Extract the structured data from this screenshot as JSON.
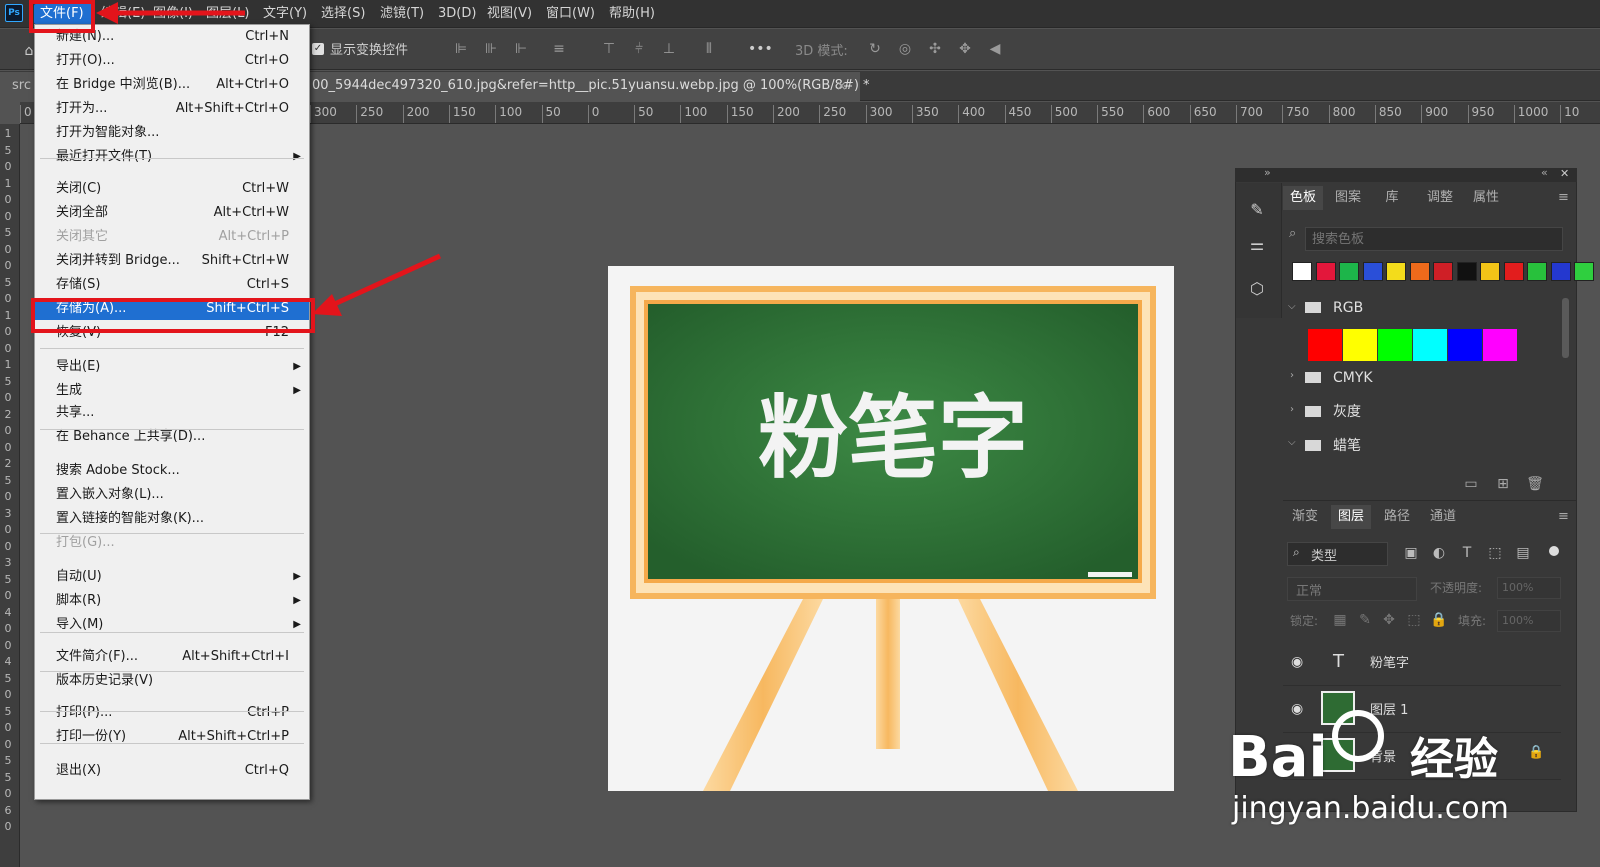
{
  "menubar": {
    "ps_logo": "Ps",
    "items": [
      "文件(F)",
      "编辑(E)",
      "图像(I)",
      "图层(L)",
      "文字(Y)",
      "选择(S)",
      "滤镜(T)",
      "3D(D)",
      "视图(V)",
      "窗口(W)",
      "帮助(H)"
    ]
  },
  "options": {
    "show_transform": "显示变换控件",
    "more": "•••",
    "mode3d": "3D 模式:"
  },
  "document": {
    "src_tab": "src",
    "tab_title": "00_5944dec497320_610.jpg&refer=http__pic.51yuansu.webp.jpg @ 100%(RGB/8#) *",
    "close": "×"
  },
  "ruler": {
    "h": [
      "0",
      "300",
      "250",
      "200",
      "150",
      "100",
      "50",
      "0",
      "50",
      "100",
      "150",
      "200",
      "250",
      "300",
      "350",
      "400",
      "450",
      "500",
      "550",
      "600",
      "650",
      "700",
      "750",
      "800",
      "850",
      "900",
      "950",
      "1000",
      "10"
    ],
    "v": [
      "1",
      "5",
      "0",
      "1",
      "0",
      "0",
      "5",
      "0",
      "0",
      "5",
      "0",
      "1",
      "0",
      "0",
      "1",
      "5",
      "0",
      "2",
      "0",
      "0",
      "2",
      "5",
      "0",
      "3",
      "0",
      "0",
      "3",
      "5",
      "0",
      "4",
      "0",
      "0",
      "4",
      "5",
      "0",
      "5",
      "0",
      "0",
      "5",
      "5",
      "0",
      "6",
      "0"
    ]
  },
  "canvas": {
    "chalk_text": "粉笔字"
  },
  "file_menu": [
    {
      "label": "新建(N)...",
      "shortcut": "Ctrl+N"
    },
    {
      "label": "打开(O)...",
      "shortcut": "Ctrl+O"
    },
    {
      "label": "在 Bridge 中浏览(B)...",
      "shortcut": "Alt+Ctrl+O"
    },
    {
      "label": "打开为...",
      "shortcut": "Alt+Shift+Ctrl+O"
    },
    {
      "label": "打开为智能对象...",
      "shortcut": ""
    },
    {
      "label": "最近打开文件(T)",
      "shortcut": ""
    },
    {
      "label": "关闭(C)",
      "shortcut": "Ctrl+W"
    },
    {
      "label": "关闭全部",
      "shortcut": "Alt+Ctrl+W"
    },
    {
      "label": "关闭其它",
      "shortcut": "Alt+Ctrl+P"
    },
    {
      "label": "关闭并转到 Bridge...",
      "shortcut": "Shift+Ctrl+W"
    },
    {
      "label": "存储(S)",
      "shortcut": "Ctrl+S"
    },
    {
      "label": "存储为(A)...",
      "shortcut": "Shift+Ctrl+S"
    },
    {
      "label": "恢复(V)",
      "shortcut": "F12"
    },
    {
      "label": "导出(E)",
      "shortcut": ""
    },
    {
      "label": "生成",
      "shortcut": ""
    },
    {
      "label": "共享...",
      "shortcut": ""
    },
    {
      "label": "在 Behance 上共享(D)...",
      "shortcut": ""
    },
    {
      "label": "搜索 Adobe Stock...",
      "shortcut": ""
    },
    {
      "label": "置入嵌入对象(L)...",
      "shortcut": ""
    },
    {
      "label": "置入链接的智能对象(K)...",
      "shortcut": ""
    },
    {
      "label": "打包(G)...",
      "shortcut": ""
    },
    {
      "label": "自动(U)",
      "shortcut": ""
    },
    {
      "label": "脚本(R)",
      "shortcut": ""
    },
    {
      "label": "导入(M)",
      "shortcut": ""
    },
    {
      "label": "文件简介(F)...",
      "shortcut": "Alt+Shift+Ctrl+I"
    },
    {
      "label": "版本历史记录(V)",
      "shortcut": ""
    },
    {
      "label": "打印(P)...",
      "shortcut": "Ctrl+P"
    },
    {
      "label": "打印一份(Y)",
      "shortcut": "Alt+Shift+Ctrl+P"
    },
    {
      "label": "退出(X)",
      "shortcut": "Ctrl+Q"
    }
  ],
  "panel": {
    "collapse_left": "»",
    "collapse_right": "«",
    "close": "✕",
    "top_tabs": [
      "色板",
      "图案",
      "库",
      "调整",
      "属性"
    ],
    "search_placeholder": "搜索色板",
    "swatch_colors": [
      "#ffffff",
      "#e3173b",
      "#1db54a",
      "#2a4fd8",
      "#f3dc1b",
      "#ee6a1b",
      "#cf1f26",
      "#111111",
      "#f2c417",
      "#e21d1d",
      "#28c13c",
      "#2438cf",
      "#2fcf3f"
    ],
    "groups": [
      "RGB",
      "CMYK",
      "灰度",
      "蜡笔"
    ],
    "rgb_colors": [
      "#ff0000",
      "#ffff00",
      "#00ff00",
      "#00ffff",
      "#0000ff",
      "#ff00ff"
    ],
    "bottom_tabs": [
      "渐变",
      "图层",
      "路径",
      "通道"
    ],
    "filter_label": "类型",
    "blend_mode": "正常",
    "opacity_label": "不透明度:",
    "opacity_value": "100%",
    "lock_label": "锁定:",
    "fill_label": "填充:",
    "fill_value": "100%",
    "layers": [
      "粉笔字",
      "图层 1",
      "背景"
    ]
  },
  "watermark": {
    "brand": "Bai",
    "brand2": "经验",
    "url": "jingyan.baidu.com"
  }
}
